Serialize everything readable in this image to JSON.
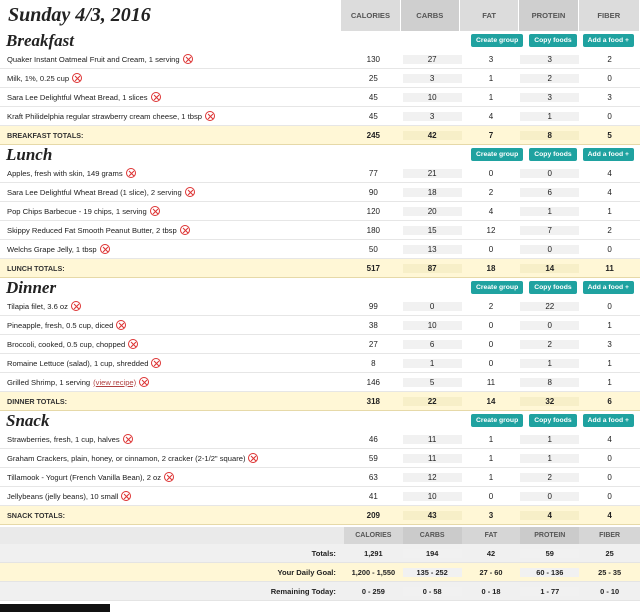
{
  "date": "Sunday 4/3, 2016",
  "columns": [
    "CALORIES",
    "CARBS",
    "FAT",
    "PROTEIN",
    "FIBER"
  ],
  "buttons": {
    "create_group": "Create group",
    "copy_foods": "Copy foods",
    "add_food": "Add a food +"
  },
  "meals": [
    {
      "name": "Breakfast",
      "items": [
        {
          "food": "Quaker Instant Oatmeal Fruit and Cream, 1 serving",
          "values": [
            "130",
            "27",
            "3",
            "3",
            "2"
          ]
        },
        {
          "food": "Milk, 1%, 0.25 cup",
          "values": [
            "25",
            "3",
            "1",
            "2",
            "0"
          ]
        },
        {
          "food": "Sara Lee Delightful Wheat Bread, 1 slices",
          "values": [
            "45",
            "10",
            "1",
            "3",
            "3"
          ]
        },
        {
          "food": "Kraft Philidelphia regular strawberry cream cheese, 1 tbsp",
          "values": [
            "45",
            "3",
            "4",
            "1",
            "0"
          ]
        }
      ],
      "totals_label": "BREAKFAST TOTALS:",
      "totals": [
        "245",
        "42",
        "7",
        "8",
        "5"
      ]
    },
    {
      "name": "Lunch",
      "items": [
        {
          "food": "Apples, fresh with skin, 149 grams",
          "values": [
            "77",
            "21",
            "0",
            "0",
            "4"
          ]
        },
        {
          "food": "Sara Lee Delightful Wheat Bread (1 slice), 2 serving",
          "values": [
            "90",
            "18",
            "2",
            "6",
            "4"
          ]
        },
        {
          "food": "Pop Chips Barbecue - 19 chips, 1 serving",
          "values": [
            "120",
            "20",
            "4",
            "1",
            "1"
          ]
        },
        {
          "food": "Skippy Reduced Fat Smooth Peanut Butter, 2 tbsp",
          "values": [
            "180",
            "15",
            "12",
            "7",
            "2"
          ]
        },
        {
          "food": "Welchs Grape Jelly, 1 tbsp",
          "values": [
            "50",
            "13",
            "0",
            "0",
            "0"
          ]
        }
      ],
      "totals_label": "LUNCH TOTALS:",
      "totals": [
        "517",
        "87",
        "18",
        "14",
        "11"
      ]
    },
    {
      "name": "Dinner",
      "items": [
        {
          "food": "Tilapia filet, 3.6 oz",
          "values": [
            "99",
            "0",
            "2",
            "22",
            "0"
          ]
        },
        {
          "food": "Pineapple, fresh, 0.5 cup, diced",
          "values": [
            "38",
            "10",
            "0",
            "0",
            "1"
          ]
        },
        {
          "food": "Broccoli, cooked, 0.5 cup, chopped",
          "values": [
            "27",
            "6",
            "0",
            "2",
            "3"
          ]
        },
        {
          "food": "Romaine Lettuce (salad), 1 cup, shredded",
          "values": [
            "8",
            "1",
            "0",
            "1",
            "1"
          ]
        },
        {
          "food": "Grilled Shrimp, 1 serving",
          "link": "(view recipe)",
          "values": [
            "146",
            "5",
            "11",
            "8",
            "1"
          ]
        }
      ],
      "totals_label": "DINNER TOTALS:",
      "totals": [
        "318",
        "22",
        "14",
        "32",
        "6"
      ]
    },
    {
      "name": "Snack",
      "items": [
        {
          "food": "Strawberries, fresh, 1 cup, halves",
          "values": [
            "46",
            "11",
            "1",
            "1",
            "4"
          ]
        },
        {
          "food": "Graham Crackers, plain, honey, or cinnamon, 2 cracker (2-1/2\" square)",
          "values": [
            "59",
            "11",
            "1",
            "1",
            "0"
          ]
        },
        {
          "food": "Tillamook - Yogurt (French Vanilla Bean), 2 oz",
          "values": [
            "63",
            "12",
            "1",
            "2",
            "0"
          ]
        },
        {
          "food": "Jellybeans (jelly beans), 10 small",
          "values": [
            "41",
            "10",
            "0",
            "0",
            "0"
          ]
        }
      ],
      "totals_label": "SNACK TOTALS:",
      "totals": [
        "209",
        "43",
        "3",
        "4",
        "4"
      ]
    }
  ],
  "summary": {
    "totals": {
      "label": "Totals:",
      "values": [
        "1,291",
        "194",
        "42",
        "59",
        "25"
      ]
    },
    "goal": {
      "label": "Your Daily Goal:",
      "values": [
        "1,200 - 1,550",
        "135 - 252",
        "27 - 60",
        "60 - 136",
        "25 - 35"
      ]
    },
    "remaining": {
      "label": "Remaining Today:",
      "values": [
        "0 - 259",
        "0 - 58",
        "0 - 18",
        "1 - 77",
        "0 - 10"
      ]
    }
  },
  "colors": {
    "button": "#1fa2a0",
    "delete_icon": "#dd3333",
    "totals_bg": "#fff7d6",
    "header_bg": "#dcdcdc"
  }
}
